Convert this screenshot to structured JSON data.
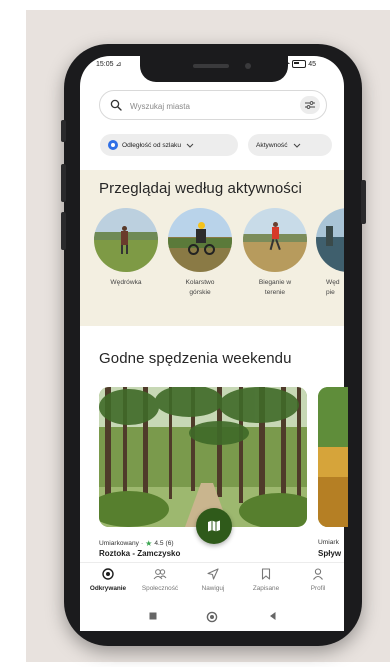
{
  "status_bar": {
    "time": "15:05",
    "battery": "45"
  },
  "search": {
    "placeholder": "Wyszukaj miasta"
  },
  "filters": {
    "distance_label": "Odległość od szlaku",
    "activity_label": "Aktywność"
  },
  "browse": {
    "title": "Przeglądaj według aktywności",
    "activities": [
      {
        "label_line1": "Wędrówka",
        "label_line2": ""
      },
      {
        "label_line1": "Kolarstwo",
        "label_line2": "górskie"
      },
      {
        "label_line1": "Bieganie w",
        "label_line2": "terenie"
      },
      {
        "label_line1": "Węd",
        "label_line2": "pie"
      }
    ]
  },
  "weekend": {
    "title": "Godne spędzenia weekendu",
    "cards": [
      {
        "difficulty": "Umiarkowany",
        "separator": "·",
        "rating": "4.5",
        "reviews": "(6)",
        "name": "Roztoka - Zamczysko"
      },
      {
        "difficulty": "Umiark",
        "name": "Spływ"
      }
    ]
  },
  "tabbar": {
    "items": [
      {
        "label": "Odkrywanie",
        "icon": "compass-icon",
        "active": true
      },
      {
        "label": "Społeczność",
        "icon": "community-icon",
        "active": false
      },
      {
        "label": "Nawiguj",
        "icon": "navigate-icon",
        "active": false
      },
      {
        "label": "Zapisane",
        "icon": "bookmark-icon",
        "active": false
      },
      {
        "label": "Profil",
        "icon": "profile-icon",
        "active": false
      }
    ]
  },
  "colors": {
    "accent_green": "#2f5a1a",
    "band_beige": "#f3efe1",
    "chip_gray": "#ededed",
    "star_green": "#3aa650"
  }
}
